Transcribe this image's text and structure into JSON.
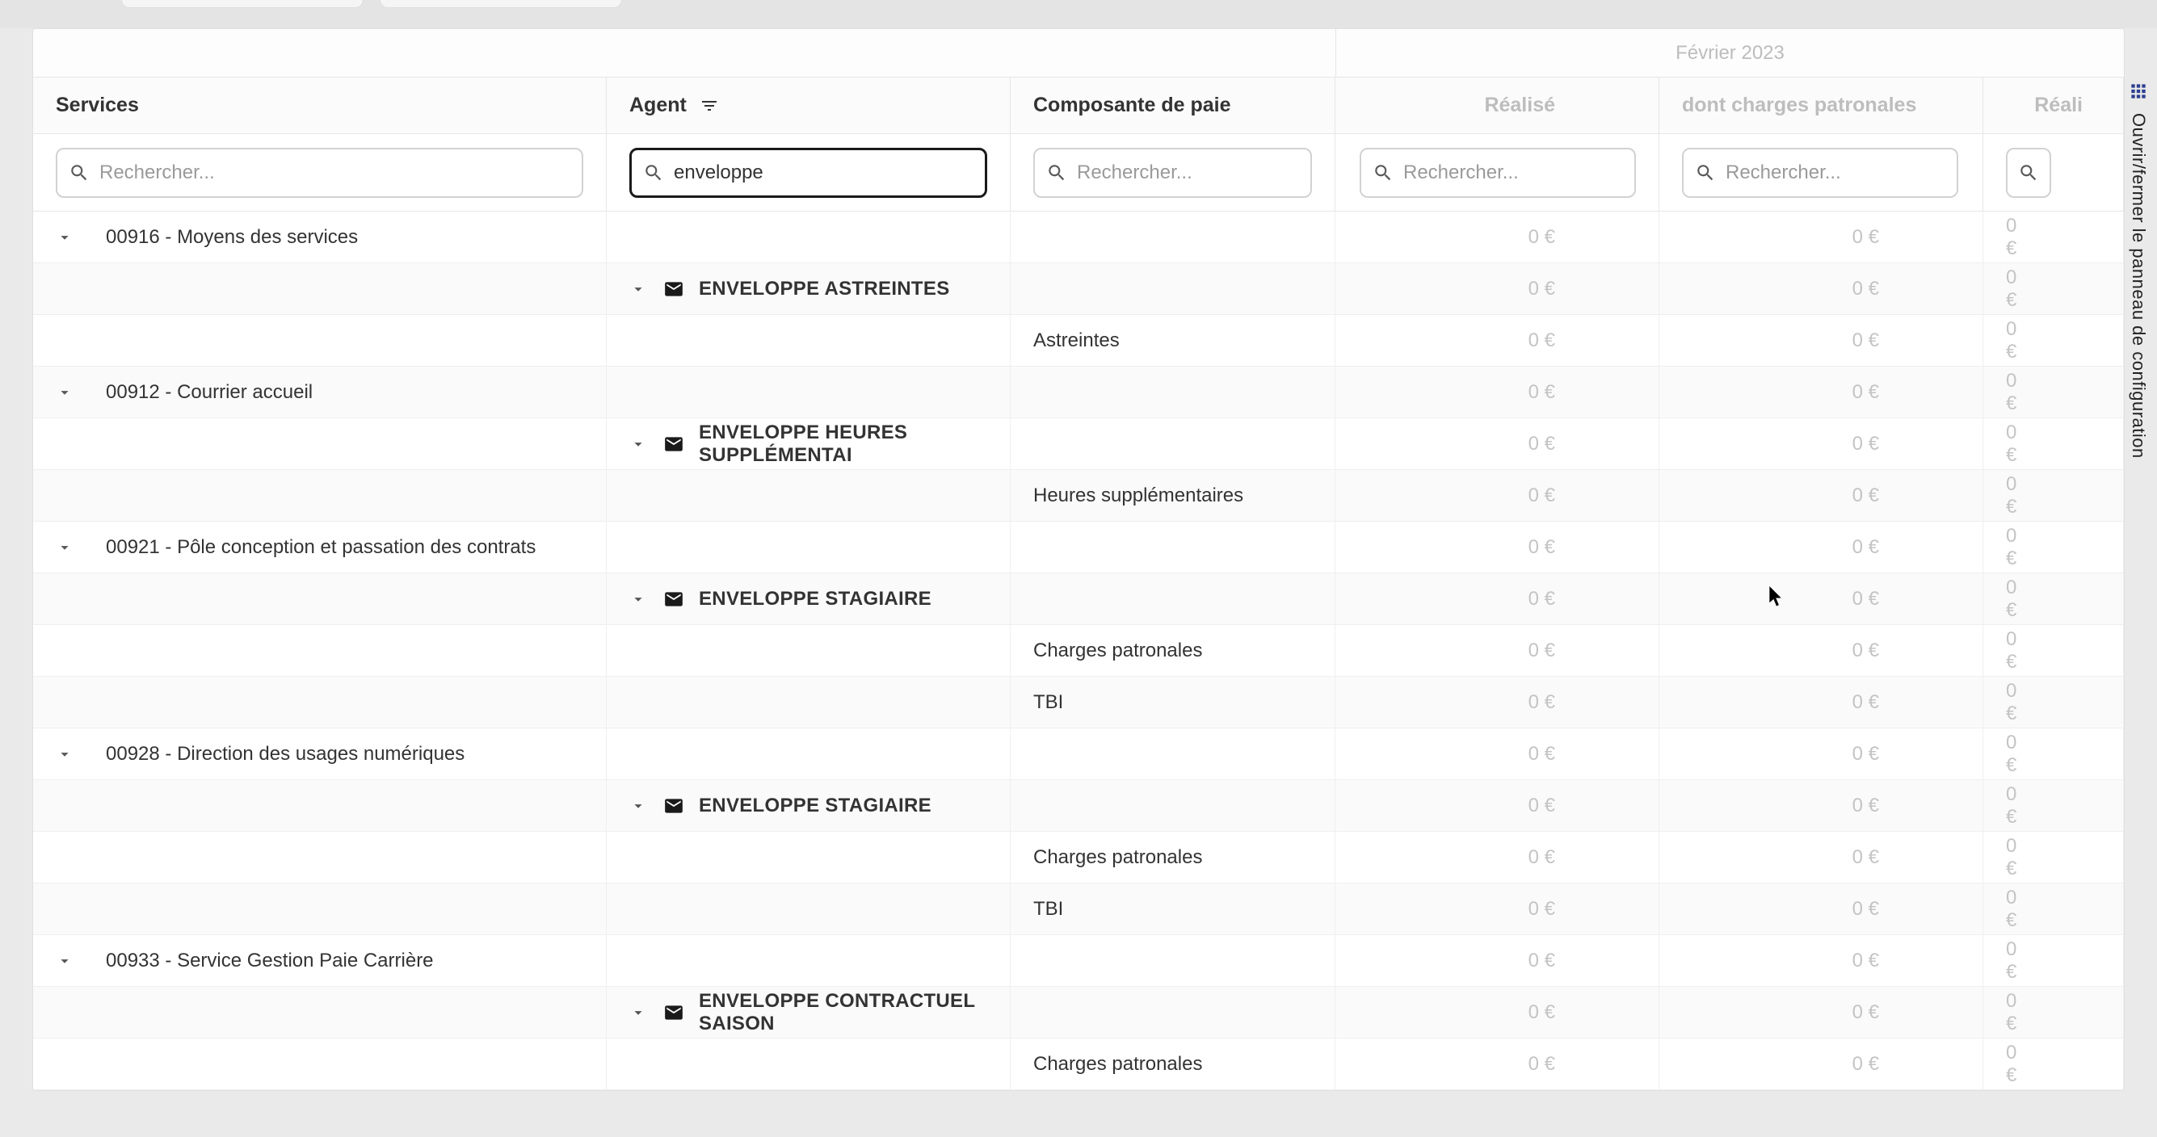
{
  "period_label": "Février 2023",
  "columns": {
    "services": "Services",
    "agent": "Agent",
    "composante": "Composante de paie",
    "realise": "Réalisé",
    "charges": "dont charges patronales",
    "realise2": "Réali"
  },
  "search": {
    "placeholder": "Rechercher...",
    "agent_value": "enveloppe"
  },
  "right_panel_label": "Ouvrir/fermer le panneau de configuration",
  "rows": {
    "svc_00916": "00916 - Moyens des services",
    "env_astreintes": "ENVELOPPE ASTREINTES",
    "comp_astreintes": "Astreintes",
    "svc_00912": "00912 - Courrier accueil",
    "env_heures_supp": "ENVELOPPE HEURES SUPPLÉMENTAI",
    "comp_heures_supp": "Heures supplémentaires",
    "svc_00921": "00921 - Pôle conception et passation des contrats",
    "env_stagiaire": "ENVELOPPE STAGIAIRE",
    "comp_charges_pat": "Charges patronales",
    "comp_tbi": "TBI",
    "svc_00928": "00928 - Direction des usages numériques",
    "env_stagiaire2": "ENVELOPPE STAGIAIRE",
    "svc_00933": "00933 - Service Gestion Paie Carrière",
    "env_contractuel": "ENVELOPPE CONTRACTUEL SAISON"
  },
  "zero_euro": "0 €"
}
